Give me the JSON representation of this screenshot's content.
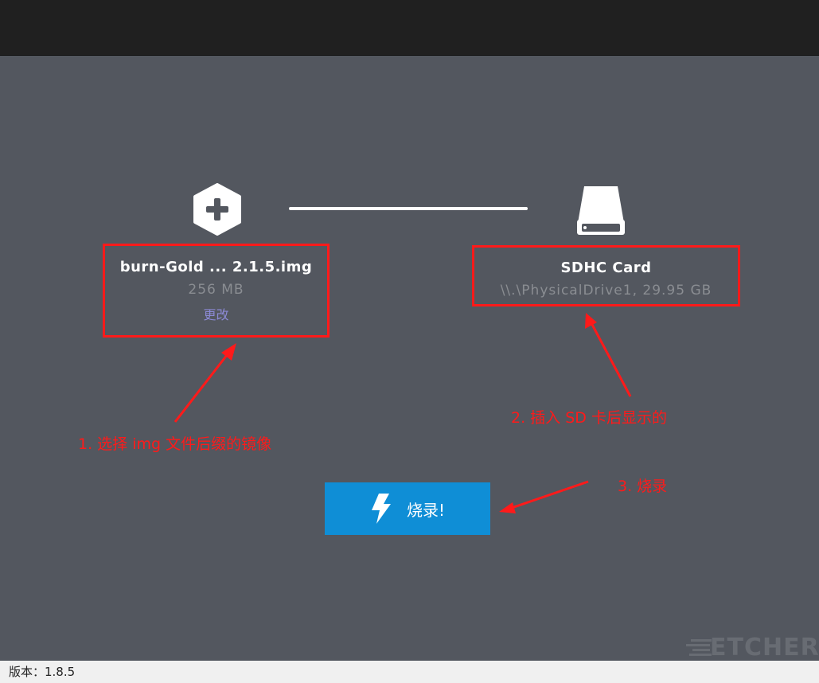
{
  "image_selection": {
    "filename": "burn-Gold ... 2.1.5.img",
    "size": "256 MB",
    "change_label": "更改"
  },
  "drive_selection": {
    "name": "SDHC Card",
    "detail": "\\\\.\\PhysicalDrive1, 29.95 GB"
  },
  "flash_button": {
    "label": "烧录!"
  },
  "annotations": {
    "step1": "1. 选择 img 文件后缀的镜像",
    "step2": "2. 插入 SD 卡后显示的",
    "step3": "3. 烧录"
  },
  "logo": {
    "text": "ETCHER"
  },
  "status": {
    "version": "版本：1.8.5"
  },
  "colors": {
    "background": "#53575f",
    "titlebar": "#202020",
    "annotation_red": "#ff1a1a",
    "button_blue": "#0f8ed6",
    "link_purple": "#8c8ad6"
  },
  "icons": [
    "plus-hexagon-icon",
    "drive-icon",
    "lightning-icon",
    "etcher-logo"
  ]
}
